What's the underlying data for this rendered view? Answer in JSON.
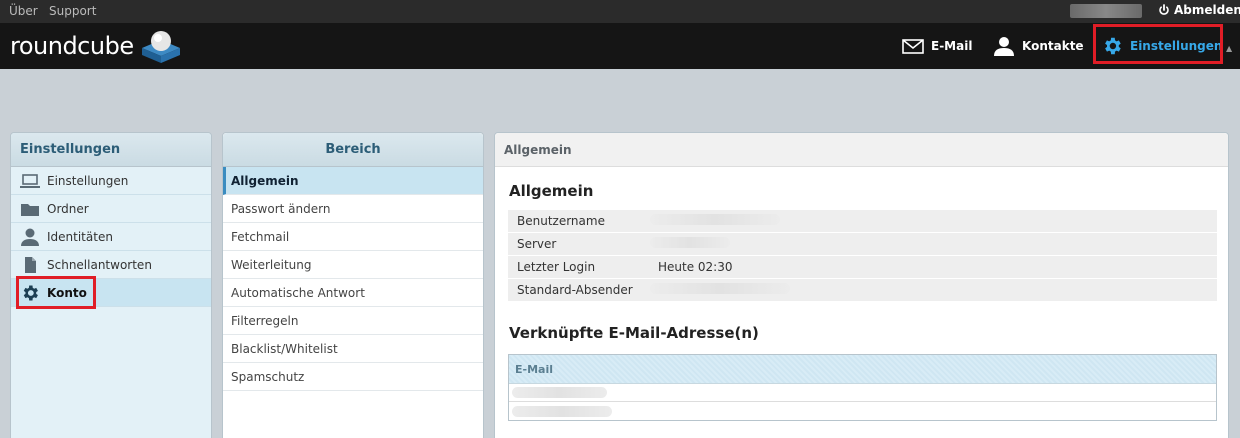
{
  "topbar": {
    "about": "Über",
    "support": "Support",
    "logout": "Abmelden"
  },
  "header": {
    "logo": "roundcube",
    "nav": {
      "mail": "E-Mail",
      "contacts": "Kontakte",
      "settings": "Einstellungen"
    }
  },
  "settings_panel": {
    "title": "Einstellungen",
    "items": [
      {
        "label": "Einstellungen",
        "icon": "laptop-icon"
      },
      {
        "label": "Ordner",
        "icon": "folder-icon"
      },
      {
        "label": "Identitäten",
        "icon": "person-icon"
      },
      {
        "label": "Schnellantworten",
        "icon": "document-icon"
      },
      {
        "label": "Konto",
        "icon": "gear-icon"
      }
    ]
  },
  "section_panel": {
    "title": "Bereich",
    "items": [
      "Allgemein",
      "Passwort ändern",
      "Fetchmail",
      "Weiterleitung",
      "Automatische Antwort",
      "Filterregeln",
      "Blacklist/Whitelist",
      "Spamschutz"
    ]
  },
  "content": {
    "header": "Allgemein",
    "general_title": "Allgemein",
    "rows": [
      {
        "key": "Benutzername",
        "value": ""
      },
      {
        "key": "Server",
        "value": ""
      },
      {
        "key": "Letzter Login",
        "value": "Heute 02:30"
      },
      {
        "key": "Standard-Absender",
        "value": ""
      }
    ],
    "linked_title": "Verknüpfte E-Mail-Adresse(n)",
    "email_column": "E-Mail"
  },
  "colors": {
    "accent": "#37a8e8",
    "highlight": "#e01d26",
    "header_bg": "#151515"
  }
}
